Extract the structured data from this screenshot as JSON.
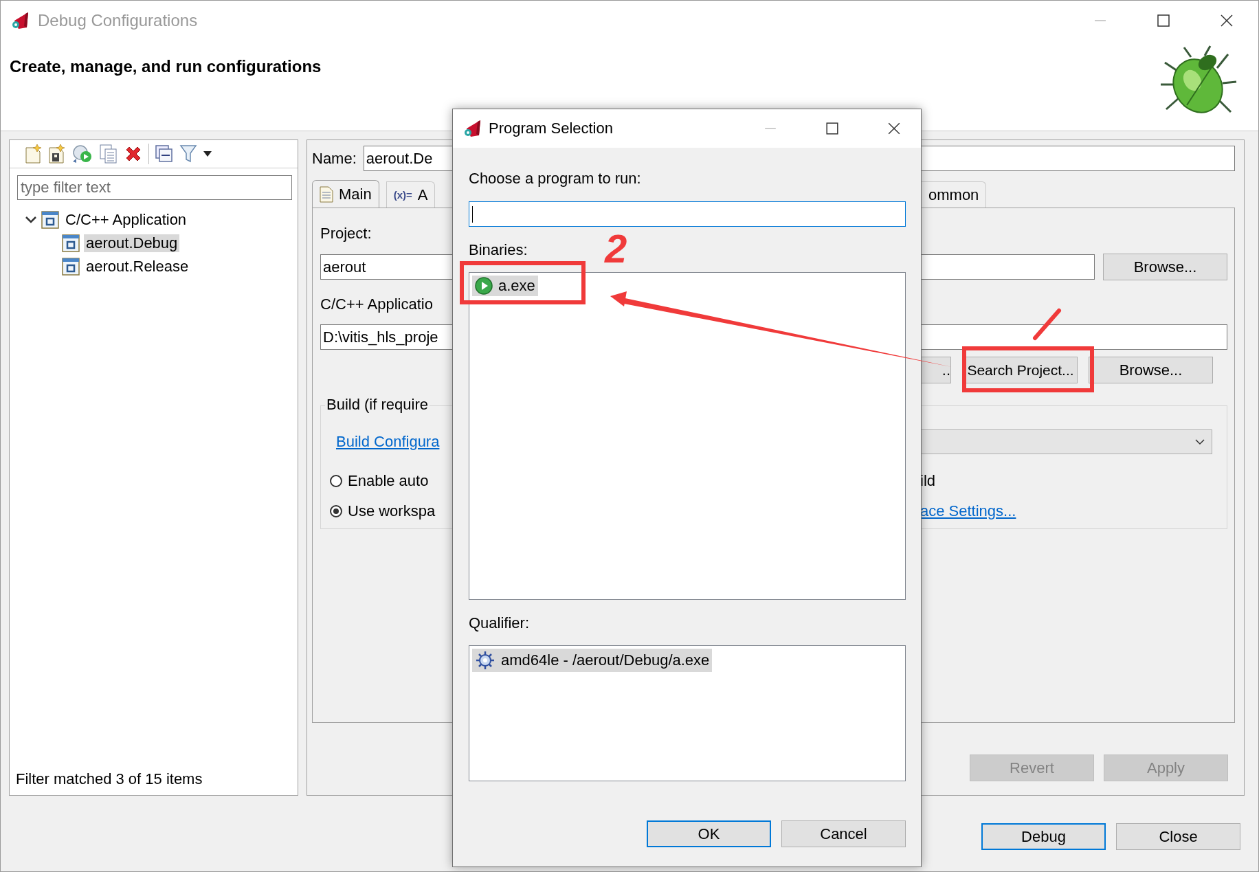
{
  "window": {
    "title": "Debug Configurations",
    "subtitle": "Create, manage, and run configurations"
  },
  "sidebar": {
    "filter_placeholder": "type filter text",
    "tree": [
      {
        "label": "C/C++ Application",
        "expanded": true,
        "children": [
          {
            "label": "aerout.Debug",
            "selected": true
          },
          {
            "label": "aerout.Release",
            "selected": false
          }
        ]
      }
    ],
    "status": "Filter matched 3 of 15 items"
  },
  "editor": {
    "name_label": "Name:",
    "name_value": "aerout.De",
    "tabs": [
      {
        "label": "Main",
        "selected": true
      },
      {
        "label": "A",
        "icon_text": "(x)=",
        "selected": false
      },
      {
        "label": "ommon",
        "selected": false
      }
    ],
    "project_label": "Project:",
    "project_value": "aerout",
    "project_button": "Browse...",
    "app_label": "C/C++ Applicatio",
    "app_value": "D:\\vitis_hls_proje",
    "app_buttons": [
      "..",
      "Search Project...",
      "Browse..."
    ],
    "build": {
      "title": "Build (if require",
      "link": "Build Configura",
      "options": [
        {
          "kind": "text",
          "label": "Enable auto",
          "tail": "ild",
          "selected": false
        },
        {
          "kind": "link",
          "label": "Use workspa",
          "tail": "ace Settings...",
          "selected": true
        }
      ]
    },
    "actions": [
      {
        "label": "Revert",
        "disabled": true
      },
      {
        "label": "Apply",
        "disabled": true
      }
    ]
  },
  "buttons": [
    {
      "label": "Debug",
      "default": true
    },
    {
      "label": "Close",
      "default": false
    }
  ],
  "dialog": {
    "title": "Program Selection",
    "prompt": "Choose a program to run:",
    "binaries_label": "Binaries:",
    "binaries": [
      {
        "label": "a.exe",
        "selected": true
      }
    ],
    "qualifier_label": "Qualifier:",
    "qualifiers": [
      {
        "label": "amd64le - /aerout/Debug/a.exe",
        "selected": true
      }
    ],
    "buttons": [
      {
        "label": "OK",
        "default": true
      },
      {
        "label": "Cancel",
        "default": false
      }
    ]
  },
  "annotation": {
    "step_number": "2"
  }
}
